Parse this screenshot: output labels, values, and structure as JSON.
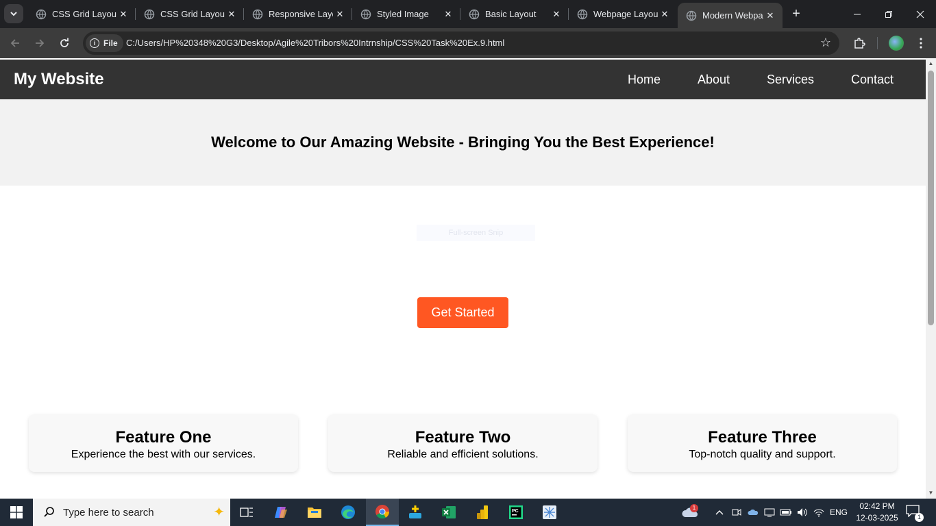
{
  "browser": {
    "tabs": [
      {
        "title": "CSS Grid Layout",
        "active": false
      },
      {
        "title": "CSS Grid Layout",
        "active": false
      },
      {
        "title": "Responsive Layout",
        "active": false
      },
      {
        "title": "Styled Image",
        "active": false
      },
      {
        "title": "Basic Layout",
        "active": false
      },
      {
        "title": "Webpage Layout",
        "active": false
      },
      {
        "title": "Modern Webpage",
        "active": true
      }
    ],
    "site_chip_label": "File",
    "url": "C:/Users/HP%20348%20G3/Desktop/Agile%20Tribors%20Intrnship/CSS%20Task%20Ex.9.html",
    "icons": {
      "tab_search": "chevron-down-icon",
      "tab_favicon": "globe-icon",
      "tab_close": "close-icon",
      "new_tab": "plus-icon",
      "back": "arrow-left-icon",
      "forward": "arrow-right-icon",
      "reload": "reload-icon",
      "info": "info-icon",
      "bookmark": "star-icon",
      "extensions": "puzzle-icon",
      "menu": "more-vertical-icon"
    }
  },
  "page": {
    "logo": "My Website",
    "nav": [
      "Home",
      "About",
      "Services",
      "Contact"
    ],
    "hero_title": "Welcome to Our Amazing Website - Bringing You the Best Experience!",
    "ghost_overlay": "Full-screen Snip",
    "cta_label": "Get Started",
    "features": [
      {
        "title": "Feature One",
        "text": "Experience the best with our services."
      },
      {
        "title": "Feature Two",
        "text": "Reliable and efficient solutions."
      },
      {
        "title": "Feature Three",
        "text": "Top-notch quality and support."
      }
    ],
    "colors": {
      "header_bg": "#333333",
      "hero_bg": "#f2f2f2",
      "cta_bg": "#ff5722",
      "card_bg": "#f8f8f8"
    }
  },
  "taskbar": {
    "search_placeholder": "Type here to search",
    "language": "ENG",
    "time": "02:42 PM",
    "date": "12-03-2025",
    "weather_badge": "1",
    "notification_count": "1",
    "apps": [
      "task-view-icon",
      "copilot-icon",
      "file-explorer-icon",
      "edge-icon",
      "chrome-icon",
      "app-icon",
      "excel-icon",
      "power-bi-icon",
      "pycharm-icon",
      "snipping-tool-icon"
    ]
  }
}
